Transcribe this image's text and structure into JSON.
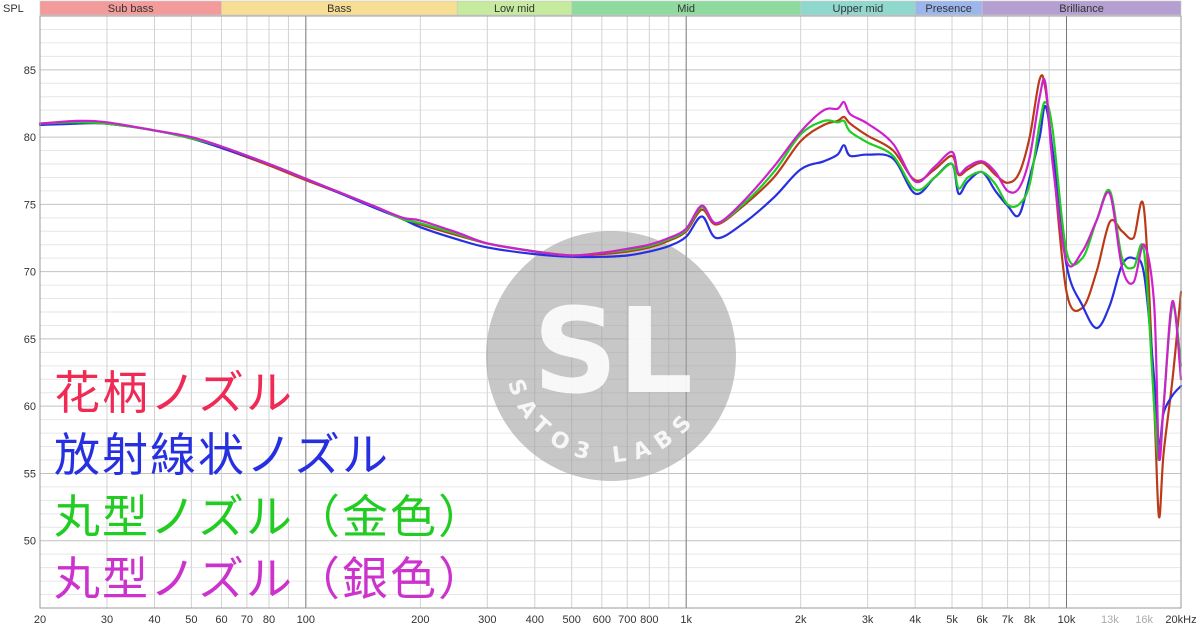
{
  "chart_data": {
    "type": "line",
    "ylabel": "SPL",
    "xlabel": "",
    "x_scale": "log",
    "xlim": [
      20,
      20000
    ],
    "ylim": [
      45,
      89
    ],
    "grid": true,
    "x_tick_labels": [
      {
        "v": 20,
        "label": "20"
      },
      {
        "v": 30,
        "label": "30"
      },
      {
        "v": 40,
        "label": "40"
      },
      {
        "v": 50,
        "label": "50"
      },
      {
        "v": 60,
        "label": "60"
      },
      {
        "v": 70,
        "label": "70"
      },
      {
        "v": 80,
        "label": "80"
      },
      {
        "v": 100,
        "label": "100"
      },
      {
        "v": 200,
        "label": "200"
      },
      {
        "v": 300,
        "label": "300"
      },
      {
        "v": 400,
        "label": "400"
      },
      {
        "v": 500,
        "label": "500"
      },
      {
        "v": 600,
        "label": "600"
      },
      {
        "v": 700,
        "label": "700"
      },
      {
        "v": 800,
        "label": "800"
      },
      {
        "v": 1000,
        "label": "1k"
      },
      {
        "v": 2000,
        "label": "2k"
      },
      {
        "v": 3000,
        "label": "3k"
      },
      {
        "v": 4000,
        "label": "4k"
      },
      {
        "v": 5000,
        "label": "5k"
      },
      {
        "v": 6000,
        "label": "6k"
      },
      {
        "v": 7000,
        "label": "7k"
      },
      {
        "v": 8000,
        "label": "8k"
      },
      {
        "v": 10000,
        "label": "10k"
      },
      {
        "v": 13000,
        "label": "13k",
        "dim": true
      },
      {
        "v": 16000,
        "label": "16k",
        "dim": true
      },
      {
        "v": 20000,
        "label": "20kHz"
      }
    ],
    "y_ticks": [
      50,
      55,
      60,
      65,
      70,
      75,
      80,
      85
    ],
    "bands": [
      {
        "label": "Sub bass",
        "from": 20,
        "to": 60,
        "color": "#f39b9b"
      },
      {
        "label": "Bass",
        "from": 60,
        "to": 250,
        "color": "#f7de92"
      },
      {
        "label": "Low mid",
        "from": 250,
        "to": 500,
        "color": "#c6eb9f"
      },
      {
        "label": "Mid",
        "from": 500,
        "to": 2000,
        "color": "#8fdb9f"
      },
      {
        "label": "Upper mid",
        "from": 2000,
        "to": 4000,
        "color": "#8fd8ce"
      },
      {
        "label": "Presence",
        "from": 4000,
        "to": 6000,
        "color": "#9cb6ec"
      },
      {
        "label": "Brilliance",
        "from": 6000,
        "to": 20000,
        "color": "#b59fd0"
      }
    ],
    "x": [
      20,
      25,
      30,
      40,
      50,
      60,
      80,
      100,
      150,
      180,
      200,
      250,
      300,
      400,
      500,
      600,
      700,
      800,
      900,
      1000,
      1100,
      1200,
      1400,
      1700,
      2000,
      2300,
      2500,
      2600,
      2700,
      3000,
      3500,
      4000,
      4500,
      5000,
      5200,
      5500,
      6000,
      6500,
      7000,
      7500,
      8000,
      8500,
      8800,
      9200,
      10000,
      11000,
      12000,
      13000,
      14000,
      15000,
      16000,
      17000,
      17500,
      18000,
      19000,
      20000
    ],
    "series": [
      {
        "color": "#bb3a1a",
        "values": [
          81.0,
          81.1,
          81.0,
          80.5,
          79.9,
          79.2,
          77.9,
          76.8,
          74.9,
          73.9,
          73.5,
          72.7,
          72.1,
          71.5,
          71.2,
          71.3,
          71.5,
          71.8,
          72.3,
          73.0,
          74.6,
          73.5,
          74.8,
          77.0,
          79.7,
          80.9,
          81.2,
          81.5,
          81.0,
          80.1,
          79.0,
          76.8,
          77.6,
          78.6,
          77.2,
          77.6,
          78.1,
          77.2,
          76.6,
          77.3,
          80.0,
          84.3,
          83.6,
          78.5,
          68.5,
          67.3,
          70.0,
          73.7,
          73.0,
          72.5,
          74.6,
          60.0,
          51.8,
          56.5,
          62.0,
          68.5
        ]
      },
      {
        "color": "#2630e0",
        "values": [
          80.9,
          81.0,
          81.0,
          80.5,
          79.9,
          79.2,
          78.0,
          76.9,
          74.8,
          73.9,
          73.3,
          72.4,
          71.8,
          71.3,
          71.1,
          71.1,
          71.2,
          71.5,
          71.9,
          72.6,
          74.1,
          72.5,
          73.5,
          75.5,
          77.6,
          78.2,
          78.7,
          79.4,
          78.6,
          78.7,
          78.4,
          75.8,
          77.0,
          78.0,
          75.8,
          76.7,
          77.4,
          76.0,
          74.9,
          74.2,
          77.0,
          80.0,
          82.3,
          79.0,
          70.5,
          67.5,
          65.8,
          67.5,
          70.5,
          71.0,
          69.8,
          62.0,
          57.0,
          59.5,
          60.8,
          61.5
        ]
      },
      {
        "color": "#22cc22",
        "values": [
          81.0,
          81.1,
          81.0,
          80.5,
          79.9,
          79.3,
          78.0,
          76.9,
          74.9,
          73.9,
          73.6,
          72.8,
          72.1,
          71.5,
          71.2,
          71.4,
          71.6,
          71.9,
          72.4,
          73.1,
          74.8,
          73.6,
          74.9,
          77.4,
          80.2,
          81.2,
          81.1,
          81.2,
          80.4,
          79.6,
          78.6,
          76.1,
          77.0,
          78.0,
          76.2,
          77.0,
          77.4,
          76.5,
          75.0,
          75.0,
          76.5,
          81.0,
          82.6,
          80.5,
          71.5,
          71.0,
          73.8,
          76.0,
          71.0,
          70.3,
          71.5,
          60.0,
          56.0,
          60.0,
          67.5,
          63.0
        ]
      },
      {
        "color": "#cc22cc",
        "values": [
          81.0,
          81.2,
          81.1,
          80.5,
          80.0,
          79.3,
          78.0,
          76.9,
          74.9,
          74.0,
          73.8,
          72.9,
          72.1,
          71.5,
          71.2,
          71.4,
          71.7,
          72.0,
          72.5,
          73.2,
          74.9,
          73.6,
          75.1,
          77.8,
          80.4,
          82.0,
          82.1,
          82.6,
          81.7,
          81.0,
          79.5,
          76.7,
          77.8,
          78.9,
          77.3,
          77.8,
          78.2,
          77.4,
          76.0,
          76.2,
          78.5,
          83.0,
          84.0,
          78.0,
          70.8,
          71.5,
          73.8,
          75.8,
          70.3,
          69.2,
          72.0,
          67.5,
          56.3,
          60.0,
          67.8,
          62.0
        ]
      }
    ]
  },
  "legend": [
    {
      "label": "花柄ノズル",
      "color": "#ee2a55"
    },
    {
      "label": "放射線状ノズル",
      "color": "#2630e0"
    },
    {
      "label": "丸型ノズル（金色）",
      "color": "#22cc22"
    },
    {
      "label": "丸型ノズル（銀色）",
      "color": "#cc33cc"
    }
  ],
  "watermark": {
    "initials": "SL",
    "ring_text": "SATO3 LABS"
  }
}
